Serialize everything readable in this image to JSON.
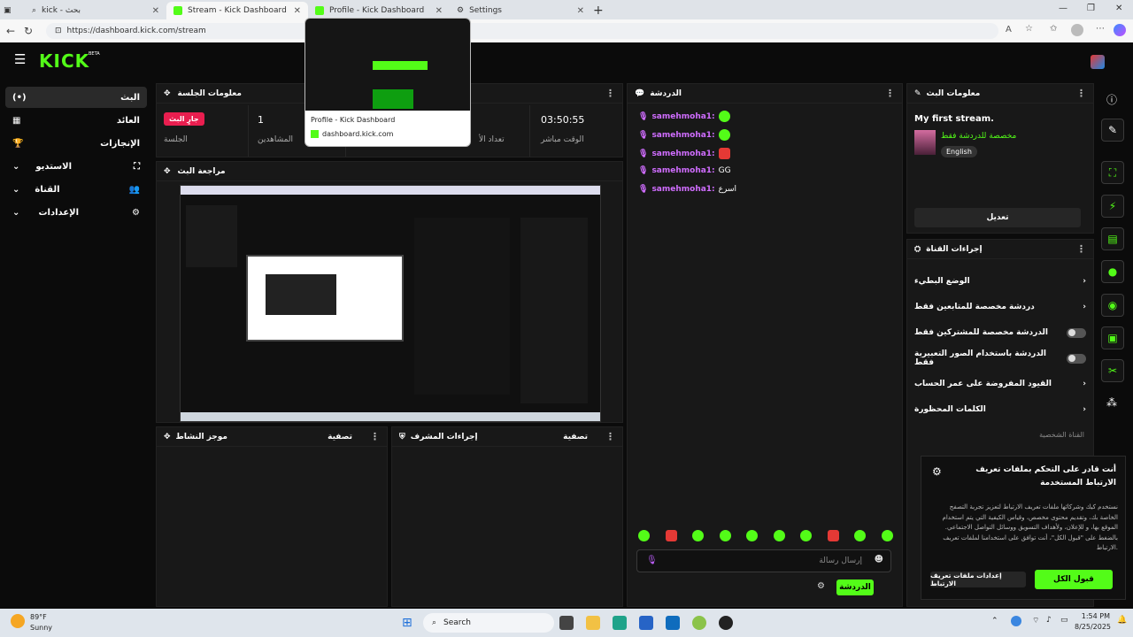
{
  "browser": {
    "tabs": [
      {
        "label": "kick - بحث",
        "active": false
      },
      {
        "label": "Stream - Kick Dashboard",
        "active": true
      },
      {
        "label": "Profile - Kick Dashboard",
        "active": false
      },
      {
        "label": "Settings",
        "active": false
      }
    ],
    "url": "https://dashboard.kick.com/stream",
    "new_tab": "+"
  },
  "tab_preview": {
    "title": "Profile - Kick Dashboard",
    "domain": "dashboard.kick.com"
  },
  "app": {
    "logo": "KICK",
    "beta": "BETA",
    "accent": "#53fc18"
  },
  "sidebar": {
    "items": [
      {
        "label": "البث",
        "icon": "(•)"
      },
      {
        "label": "العائد",
        "icon": "▦"
      },
      {
        "label": "الإنجازات",
        "icon": "🏆"
      },
      {
        "label": "الاستديو",
        "icon": "⛶"
      },
      {
        "label": "القناة",
        "icon": "👥"
      },
      {
        "label": "الإعدادات",
        "icon": "⚙"
      }
    ]
  },
  "session": {
    "title": "معلومات الجلسة",
    "badge": "جارٍ البث",
    "stats": [
      {
        "label": "الجلسة",
        "value": ""
      },
      {
        "label": "المشاهدين",
        "value": "1"
      },
      {
        "label": "تعداد الأ",
        "value": ""
      },
      {
        "label": "الوقت مباشر",
        "value": "03:50:55"
      }
    ]
  },
  "preview_panel": {
    "title": "مراجعة البث"
  },
  "activity": {
    "title": "موجز النشاط",
    "filter": "تصفية"
  },
  "mod_actions": {
    "title": "إجراءات المشرف",
    "filter": "تصفية"
  },
  "chat": {
    "title": "الدردشة",
    "messages": [
      {
        "user": "samehmoha1:",
        "msg": "",
        "emote": "green"
      },
      {
        "user": "samehmoha1:",
        "msg": "",
        "emote": "green"
      },
      {
        "user": "samehmoha1:",
        "msg": "",
        "emote": "red"
      },
      {
        "user": "samehmoha1:",
        "msg": "GG",
        "emote": ""
      },
      {
        "user": "samehmoha1:",
        "msg": "اسرع",
        "emote": ""
      }
    ],
    "placeholder": "إرسال رسالة",
    "send": "الدردشة"
  },
  "stream_info": {
    "title": "معلومات البث",
    "stream_title": "My first stream.",
    "category": "مخصصة للدردشة فقط",
    "language": "English",
    "edit": "تعديل"
  },
  "channel_actions": {
    "title": "إجراءات القناة",
    "rows": [
      {
        "label": "الوضع البطيء",
        "type": "arrow"
      },
      {
        "label": "دردشة مخصصة للمتابعين فقط",
        "type": "arrow"
      },
      {
        "label": "الدردشة مخصصة للمشتركين فقط",
        "type": "toggle"
      },
      {
        "label": "الدردشة باستخدام الصور التعبيرية فقط",
        "type": "toggle"
      },
      {
        "label": "القيود المفروضة على عمر الحساب",
        "type": "arrow"
      },
      {
        "label": "الكلمات المحظورة",
        "type": "arrow"
      }
    ],
    "footer": "القناة الشخصية"
  },
  "cookie": {
    "title": "أنت قادر على التحكم بملفات تعريف الارتباط المستخدمة",
    "body": "نستخدم كيك وشركائها ملفات تعريف الارتباط لتعزيز تجربة التصفح الخاصة بك، وتقديم محتوى مخصص، وقياس الكيفية التي يتم استخدام الموقع بها، و للإعلان، ولأهداف التسويق ووسائل التواصل الاجتماعي. بالضغط على \"قبول الكل\"، أنت توافق على استخدامنا لملفات تعريف الارتباط.",
    "settings": "إعدادات ملفات تعريف الارتباط",
    "accept": "قبول الكل"
  },
  "taskbar": {
    "temp": "89°F",
    "weather": "Sunny",
    "search": "Search",
    "time": "1:54 PM",
    "date": "8/25/2025"
  }
}
